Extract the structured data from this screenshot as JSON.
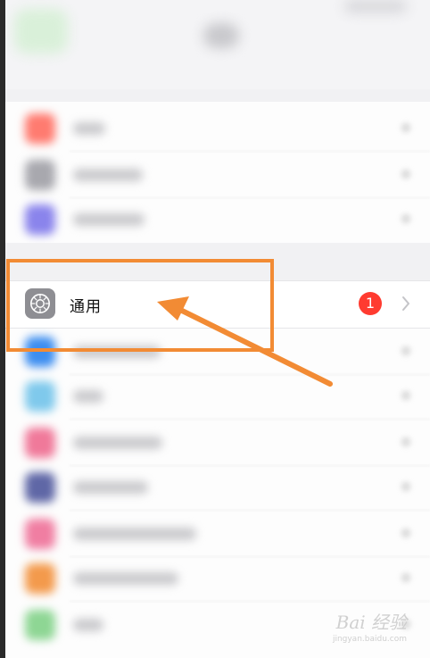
{
  "settings": {
    "general_label": "通用",
    "general_badge": "1",
    "general_icon": "gear-icon",
    "chevron_icon": "chevron-right-icon"
  },
  "annotation": {
    "color": "#f28b34"
  },
  "watermark": {
    "main": "Bai 经验",
    "sub": "jingyan.baidu.com"
  },
  "colors": {
    "badge": "#ff3b30",
    "gear_icon_bg": "#8e8e93"
  }
}
